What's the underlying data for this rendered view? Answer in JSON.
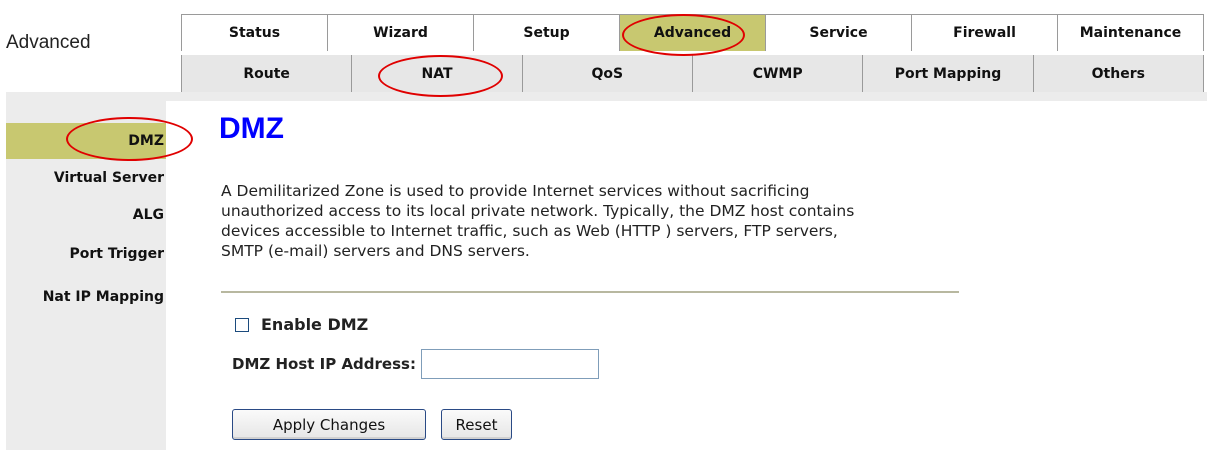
{
  "section_title": "Advanced",
  "top_nav": [
    {
      "label": "Status",
      "active": false
    },
    {
      "label": "Wizard",
      "active": false
    },
    {
      "label": "Setup",
      "active": false
    },
    {
      "label": "Advanced",
      "active": true
    },
    {
      "label": "Service",
      "active": false
    },
    {
      "label": "Firewall",
      "active": false
    },
    {
      "label": "Maintenance",
      "active": false
    }
  ],
  "sub_nav": [
    {
      "label": "Route"
    },
    {
      "label": "NAT"
    },
    {
      "label": "QoS"
    },
    {
      "label": "CWMP"
    },
    {
      "label": "Port Mapping"
    },
    {
      "label": "Others"
    }
  ],
  "sidebar": {
    "items": [
      {
        "label": "DMZ",
        "active": true
      },
      {
        "label": "Virtual Server",
        "active": false
      },
      {
        "label": "ALG",
        "active": false
      },
      {
        "label": "Port Trigger",
        "active": false
      },
      {
        "label": "Nat IP Mapping",
        "active": false
      }
    ]
  },
  "main": {
    "heading": "DMZ",
    "description_lines": [
      "A Demilitarized Zone is used to provide Internet services without sacrificing",
      "unauthorized access to its local private network. Typically, the DMZ host contains",
      "devices accessible to Internet traffic, such as Web (HTTP ) servers, FTP servers,",
      "SMTP (e-mail) servers and DNS servers."
    ],
    "enable_label": "Enable DMZ",
    "enable_checked": false,
    "host_ip_label": "DMZ Host IP Address:",
    "host_ip_value": "",
    "apply_label": "Apply Changes",
    "reset_label": "Reset"
  },
  "colors": {
    "active_highlight": "#c8c870",
    "heading_blue": "#0000ff",
    "annotation_red": "#e00000"
  }
}
